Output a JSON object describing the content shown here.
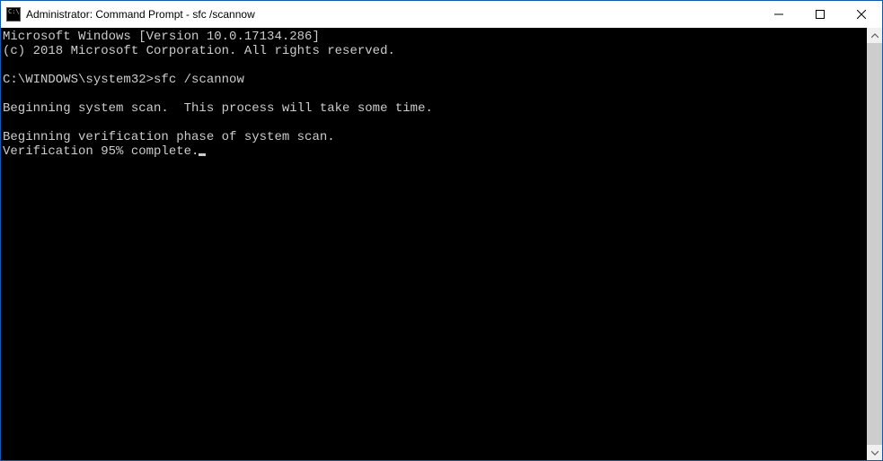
{
  "window": {
    "title": "Administrator: Command Prompt - sfc  /scannow"
  },
  "console": {
    "header1": "Microsoft Windows [Version 10.0.17134.286]",
    "header2": "(c) 2018 Microsoft Corporation. All rights reserved.",
    "prompt_path": "C:\\WINDOWS\\system32>",
    "command": "sfc /scannow",
    "line_begin_scan": "Beginning system scan.  This process will take some time.",
    "line_verify_phase": "Beginning verification phase of system scan.",
    "line_progress": "Verification 95% complete."
  }
}
